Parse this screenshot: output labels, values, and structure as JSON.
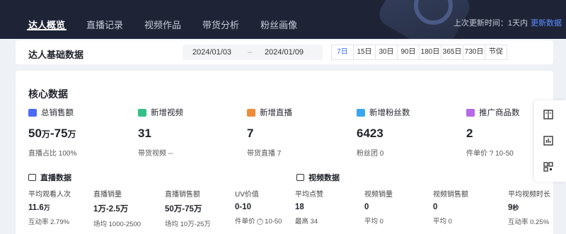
{
  "nav": {
    "tabs": [
      "达人概览",
      "直播记录",
      "视频作品",
      "带货分析",
      "粉丝画像"
    ],
    "active_tab": 0,
    "update_label": "上次更新时间：1天内",
    "update_link": "更新数据"
  },
  "base": {
    "title": "达人基础数据",
    "date_start": "2024/01/03",
    "date_sep": "–",
    "date_end": "2024/01/09",
    "periods": [
      "7日",
      "15日",
      "30日",
      "90日",
      "180日",
      "365日",
      "730日",
      "节促"
    ],
    "active_period": 0
  },
  "core": {
    "title": "核心数据",
    "metrics": [
      {
        "icon": "sales-icon",
        "color": "#4a6cf7",
        "label": "总销售额",
        "value_a": "50",
        "unit_a": "万",
        "sep": "-",
        "value_b": "75",
        "unit_b": "万",
        "sub": "直播占比 100%"
      },
      {
        "icon": "video-icon",
        "color": "#35c08a",
        "label": "新增视频",
        "value": "31",
        "sub": "带货视频 --"
      },
      {
        "icon": "live-icon",
        "color": "#f08b3a",
        "label": "新增直播",
        "value": "7",
        "sub": "带货直播 7"
      },
      {
        "icon": "fans-icon",
        "color": "#3aa6f0",
        "label": "新增粉丝数",
        "value": "6423",
        "sub": "粉丝团 0"
      },
      {
        "icon": "product-icon",
        "color": "#b668e8",
        "label": "推广商品数",
        "value": "2",
        "sub": "件单价 ? 10-50"
      }
    ]
  },
  "live": {
    "title": "直播数据",
    "items": [
      {
        "label": "平均观看人次",
        "value": "11.6",
        "unit": "万",
        "sub": "互动率 2.79%"
      },
      {
        "label": "直播销量",
        "value": "1万-2.5万",
        "sub": "场均 1000-2500"
      },
      {
        "label": "直播销售额",
        "value": "50万-75万",
        "sub": "场均 10万-25万"
      },
      {
        "label": "UV价值",
        "value": "0-10",
        "sub": "件单价",
        "sub2": "10-50"
      }
    ]
  },
  "video": {
    "title": "视频数据",
    "items": [
      {
        "label": "平均点赞",
        "value": "18",
        "sub": "最高 34"
      },
      {
        "label": "视频销量",
        "value": "0",
        "sub": "平均 0"
      },
      {
        "label": "视频销售额",
        "value": "0",
        "sub": "平均 0"
      },
      {
        "label": "平均视频时长",
        "value": "9",
        "unit": "秒",
        "sub": "互动率 0.25%"
      }
    ]
  }
}
